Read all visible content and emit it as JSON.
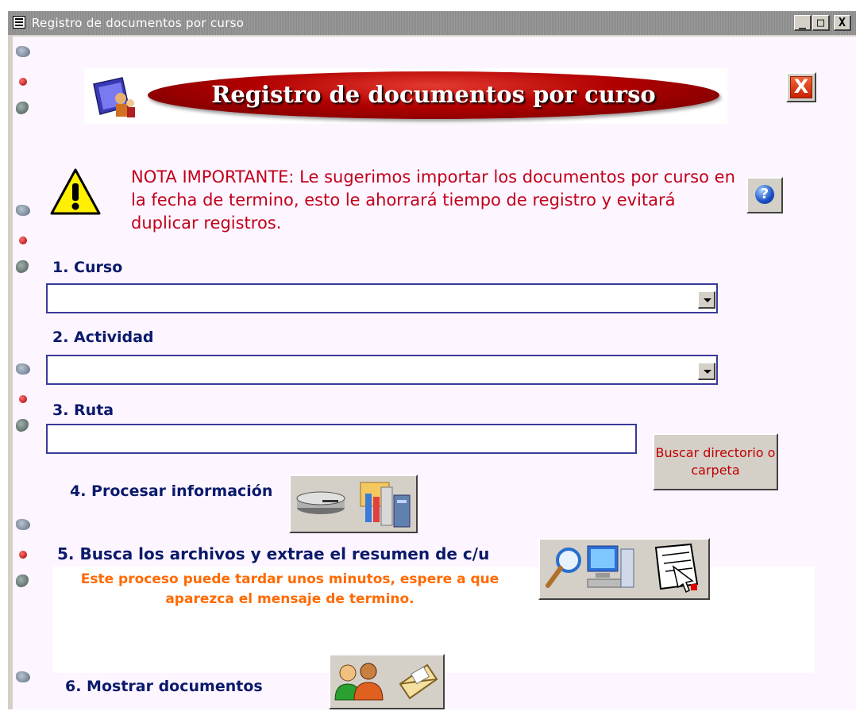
{
  "window": {
    "title": "Registro de documentos por curso",
    "minimize_glyph": "_",
    "maximize_glyph": "□",
    "close_glyph": "X"
  },
  "header": {
    "banner_title": "Registro de documentos por curso",
    "close_glyph": "X",
    "banner_color": "#b10000"
  },
  "note": {
    "text": "NOTA IMPORTANTE: Le sugerimos importar los documentos por curso en la fecha de termino, esto le ahorrará tiempo de registro y evitará duplicar registros.",
    "help_glyph": "?",
    "color": "#c0001b"
  },
  "steps": {
    "curso": {
      "label": "1. Curso",
      "value": ""
    },
    "actividad": {
      "label": "2. Actividad",
      "value": ""
    },
    "ruta": {
      "label": "3. Ruta",
      "value": "",
      "button_label": "Buscar directorio o carpeta"
    },
    "procesar": {
      "label": "4. Procesar información"
    },
    "busca": {
      "label": "5. Busca los archivos y extrae el resumen de c/u",
      "warning": "Este proceso puede tardar unos minutos, espere a que aparezca el mensaje de termino."
    },
    "mostrar": {
      "label": "6. Mostrar documentos"
    }
  },
  "icons": [
    "form-icon",
    "folder-users-icon",
    "warning-icon",
    "help-icon",
    "disk-drive-icon",
    "folder-tools-icon",
    "magnifier-icon",
    "computer-icon",
    "notepad-arrow-icon",
    "users-icon",
    "open-envelope-icon"
  ],
  "colors": {
    "label": "#0a1a6b",
    "warning_text": "#ff6a00",
    "client_bg": "#fdf5ff"
  }
}
